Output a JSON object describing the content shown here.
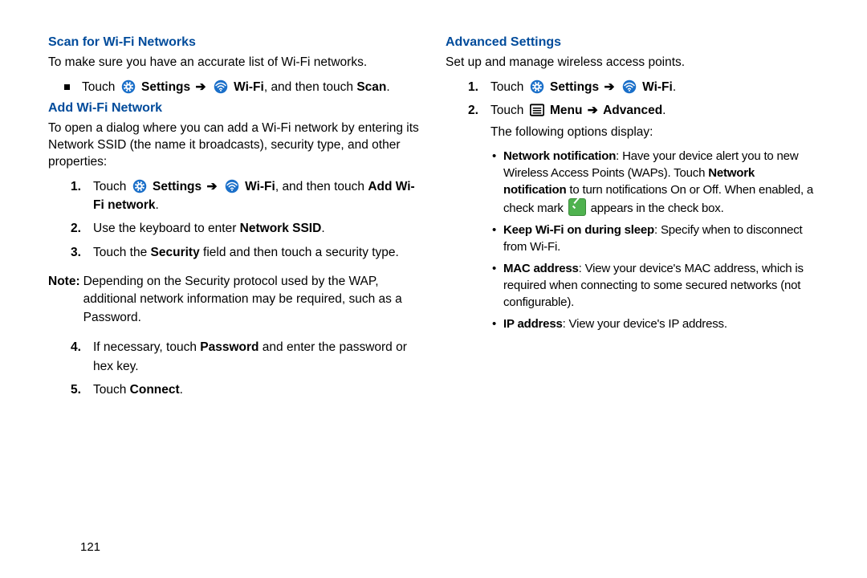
{
  "left": {
    "h1": "Scan for Wi-Fi Networks",
    "p1": "To make sure you have an accurate list of Wi-Fi networks.",
    "b1_pre": "Touch ",
    "b1_settings": "Settings",
    "b1_wifi": "Wi-Fi",
    "b1_post": ", and then touch ",
    "b1_scan": "Scan",
    "h2": "Add Wi-Fi Network",
    "p2": "To open a dialog where you can add a Wi-Fi network by entering its Network SSID (the name it broadcasts), security type, and other properties:",
    "s1_pre": "Touch ",
    "s1_settings": "Settings",
    "s1_wifi": "Wi-Fi",
    "s1_post": ", and then touch ",
    "s1_add": "Add Wi-Fi network",
    "s2_pre": "Use the keyboard to enter ",
    "s2_b": "Network SSID",
    "s3_pre": "Touch the ",
    "s3_b": "Security",
    "s3_post": " field and then touch a security type.",
    "note_label": "Note:",
    "note": "Depending on the Security protocol used by the WAP, additional network information may be required, such as a Password.",
    "s4_pre": "If necessary, touch ",
    "s4_b": "Password",
    "s4_post": " and enter the password or hex key.",
    "s5_pre": "Touch ",
    "s5_b": "Connect"
  },
  "right": {
    "h1": "Advanced Settings",
    "p1": "Set up and manage wireless access points.",
    "s1_pre": "Touch ",
    "s1_settings": "Settings",
    "s1_wifi": "Wi-Fi",
    "s2_pre": "Touch ",
    "s2_menu": "Menu",
    "s2_adv": "Advanced",
    "p2": "The following options display:",
    "o1_b": "Network notification",
    "o1_pre": ": Have your device alert you to new Wireless Access Points (WAPs). Touch ",
    "o1_b2": "Network notification",
    "o1_mid": " to turn notifications On or Off. When enabled, a check mark ",
    "o1_post": " appears in the check box.",
    "o2_b": "Keep Wi-Fi on during sleep",
    "o2": ": Specify when to disconnect from Wi-Fi.",
    "o3_b": "MAC address",
    "o3": ": View your device's MAC address, which is required when connecting to some secured networks (not configurable).",
    "o4_b": "IP address",
    "o4": ": View your device's IP address."
  },
  "pagenum": "121"
}
